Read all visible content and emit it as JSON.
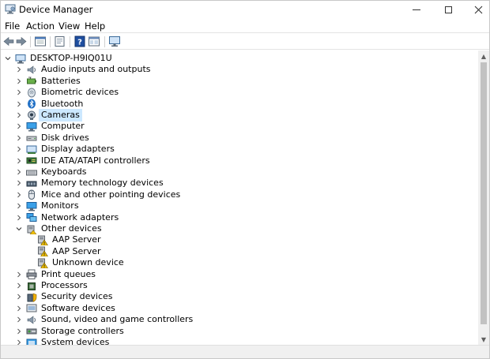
{
  "window": {
    "title": "Device Manager"
  },
  "menu": [
    "File",
    "Action",
    "View",
    "Help"
  ],
  "toolbar": [
    "back-icon",
    "forward-icon",
    "properties-window-icon",
    "update-driver-icon",
    "help-icon",
    "view-icon",
    "monitor-scan-icon"
  ],
  "tree": {
    "root": "DESKTOP-H9IQ01U",
    "nodes": [
      {
        "label": "Audio inputs and outputs",
        "icon": "speaker-icon",
        "level": 1,
        "state": "collapsed"
      },
      {
        "label": "Batteries",
        "icon": "battery-icon",
        "level": 1,
        "state": "collapsed"
      },
      {
        "label": "Biometric devices",
        "icon": "fingerprint-icon",
        "level": 1,
        "state": "collapsed"
      },
      {
        "label": "Bluetooth",
        "icon": "bluetooth-icon",
        "level": 1,
        "state": "collapsed"
      },
      {
        "label": "Cameras",
        "icon": "camera-icon",
        "level": 1,
        "state": "collapsed",
        "selected": true
      },
      {
        "label": "Computer",
        "icon": "computer-icon",
        "level": 1,
        "state": "collapsed"
      },
      {
        "label": "Disk drives",
        "icon": "disk-drive-icon",
        "level": 1,
        "state": "collapsed"
      },
      {
        "label": "Display adapters",
        "icon": "display-adapter-icon",
        "level": 1,
        "state": "collapsed"
      },
      {
        "label": "IDE ATA/ATAPI controllers",
        "icon": "ide-controller-icon",
        "level": 1,
        "state": "collapsed"
      },
      {
        "label": "Keyboards",
        "icon": "keyboard-icon",
        "level": 1,
        "state": "collapsed"
      },
      {
        "label": "Memory technology devices",
        "icon": "memory-icon",
        "level": 1,
        "state": "collapsed"
      },
      {
        "label": "Mice and other pointing devices",
        "icon": "mouse-icon",
        "level": 1,
        "state": "collapsed"
      },
      {
        "label": "Monitors",
        "icon": "monitor-icon",
        "level": 1,
        "state": "collapsed"
      },
      {
        "label": "Network adapters",
        "icon": "network-adapter-icon",
        "level": 1,
        "state": "collapsed"
      },
      {
        "label": "Other devices",
        "icon": "other-devices-icon",
        "level": 1,
        "state": "expanded"
      },
      {
        "label": "AAP Server",
        "icon": "warning-device-icon",
        "level": 2,
        "state": "leaf"
      },
      {
        "label": "AAP Server",
        "icon": "warning-device-icon",
        "level": 2,
        "state": "leaf"
      },
      {
        "label": "Unknown device",
        "icon": "warning-device-icon",
        "level": 2,
        "state": "leaf"
      },
      {
        "label": "Print queues",
        "icon": "printer-icon",
        "level": 1,
        "state": "collapsed"
      },
      {
        "label": "Processors",
        "icon": "processor-icon",
        "level": 1,
        "state": "collapsed"
      },
      {
        "label": "Security devices",
        "icon": "security-icon",
        "level": 1,
        "state": "collapsed"
      },
      {
        "label": "Software devices",
        "icon": "software-device-icon",
        "level": 1,
        "state": "collapsed"
      },
      {
        "label": "Sound, video and game controllers",
        "icon": "speaker-icon",
        "level": 1,
        "state": "collapsed"
      },
      {
        "label": "Storage controllers",
        "icon": "storage-controller-icon",
        "level": 1,
        "state": "collapsed"
      },
      {
        "label": "System devices",
        "icon": "system-devices-icon",
        "level": 1,
        "state": "collapsed"
      }
    ]
  },
  "colors": {
    "selection": "#cce8ff",
    "accent": "#1f6fc5",
    "warning": "#f2c200"
  }
}
